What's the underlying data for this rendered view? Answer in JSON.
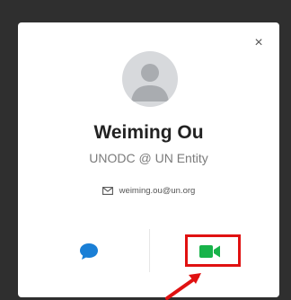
{
  "profile_card": {
    "name": "Weiming Ou",
    "organization": "UNODC @ UN Entity",
    "email": "weiming.ou@un.org",
    "close_glyph": "×"
  },
  "actions": {
    "chat_icon": "chat-bubble-icon",
    "video_icon": "video-camera-icon"
  },
  "colors": {
    "chat": "#1a7fd6",
    "video": "#18b34a",
    "highlight": "#e01111",
    "backdrop": "#2f2f2f"
  }
}
